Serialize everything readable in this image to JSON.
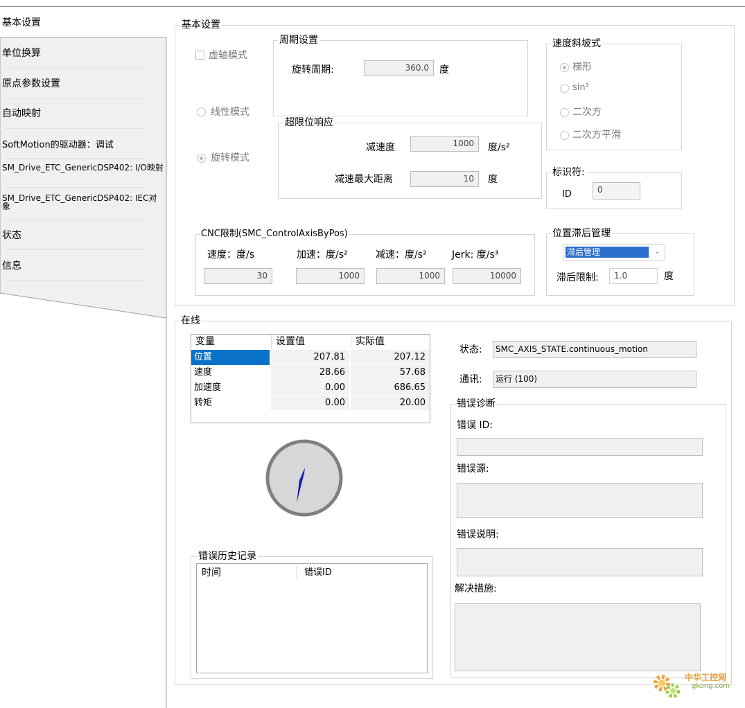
{
  "nav": {
    "items": [
      {
        "label": "基本设置"
      },
      {
        "label": "单位换算"
      },
      {
        "label": "原点参数设置"
      },
      {
        "label": "自动映射"
      },
      {
        "label": "SoftMotion的驱动器：调试"
      },
      {
        "label": "SM_Drive_ETC_GenericDSP402: I/O映射"
      },
      {
        "label": "SM_Drive_ETC_GenericDSP402: IEC对象"
      },
      {
        "label": "状态"
      },
      {
        "label": "信息"
      }
    ]
  },
  "basic": {
    "title": "基本设置",
    "virtual_mode": "虚轴模式",
    "linear_mode": "线性模式",
    "rotary_mode": "旋转模式",
    "period": {
      "title": "周期设置",
      "label": "旋转周期:",
      "value": "360.0",
      "unit": "度"
    },
    "limit": {
      "title": "超限位响应",
      "decel_label": "减速度",
      "decel_value": "1000",
      "decel_unit": "度/s²",
      "dist_label": "减速最大距离",
      "dist_value": "10",
      "dist_unit": "度"
    },
    "ramp": {
      "title": "速度斜坡式",
      "options": [
        "梯形",
        "sin²",
        "二次方",
        "二次方平滑"
      ]
    },
    "ident": {
      "title": "标识符:",
      "id_label": "ID",
      "id_value": "0"
    },
    "cnc": {
      "title": "CNC限制(SMC_ControlAxisByPos)",
      "vel_label": "速度：度/s",
      "vel_value": "30",
      "acc_label": "加速：度/s²",
      "acc_value": "1000",
      "dec_label": "减速：度/s²",
      "dec_value": "1000",
      "jerk_label": "Jerk: 度/s³",
      "jerk_value": "10000"
    },
    "lag": {
      "title": "位置滞后管理",
      "selected": "滞后管理",
      "limit_label": "滞后限制:",
      "limit_value": "1.0",
      "limit_unit": "度"
    }
  },
  "online": {
    "title": "在线",
    "table": {
      "headers": [
        "变量",
        "设置值",
        "实际值"
      ],
      "rows": [
        {
          "name": "位置",
          "set": "207.81",
          "actual": "207.12"
        },
        {
          "name": "速度",
          "set": "28.66",
          "actual": "57.68"
        },
        {
          "name": "加速度",
          "set": "0.00",
          "actual": "686.65"
        },
        {
          "name": "转矩",
          "set": "0.00",
          "actual": "20.00"
        }
      ]
    },
    "state_label": "状态:",
    "state_value": "SMC_AXIS_STATE.continuous_motion",
    "comm_label": "通讯:",
    "comm_value": "运行 (100)",
    "diag": {
      "title": "错误诊断",
      "id_label": "错误 ID:",
      "source_label": "错误源:",
      "desc_label": "错误说明:",
      "fix_label": "解决措施:"
    },
    "history": {
      "title": "错误历史记录",
      "col_time": "时间",
      "col_id": "错误ID"
    }
  },
  "watermark": {
    "line1": "中华工控网",
    "line2": "gkong.com"
  },
  "colors": {
    "selection": "#0a72c8",
    "needle": "#1a1ab4",
    "gauge_ring": "#808080"
  }
}
